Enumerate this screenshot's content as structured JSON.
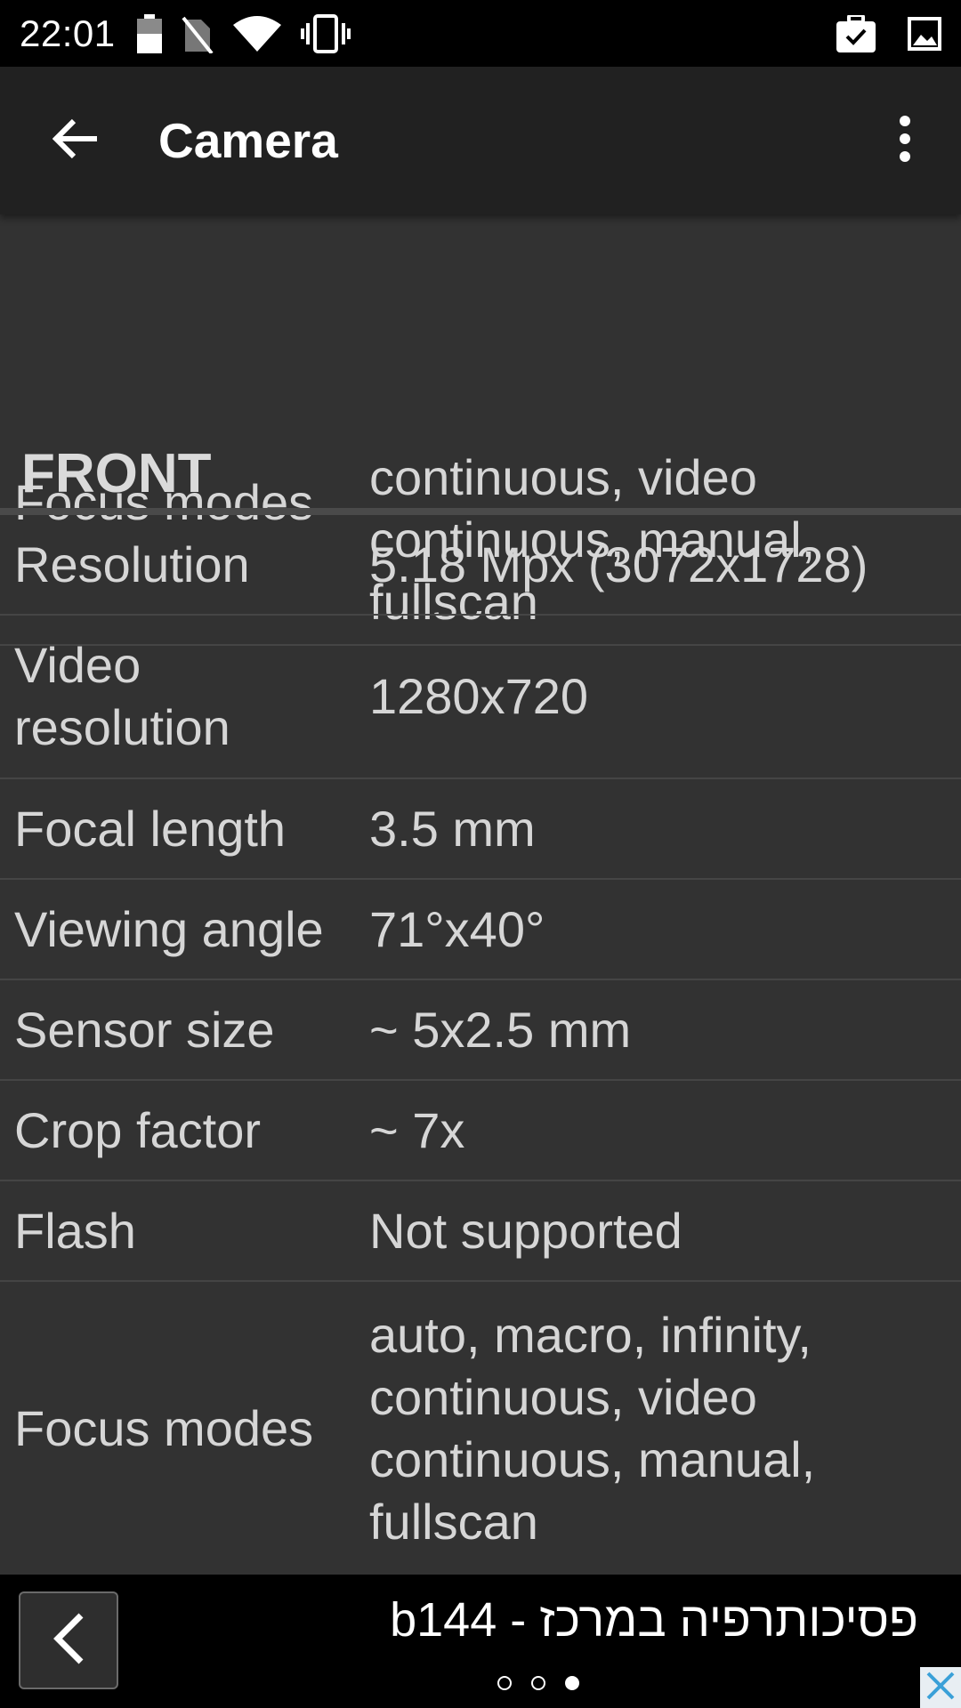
{
  "status_bar": {
    "time": "22:01",
    "icons": [
      "battery-icon",
      "no-sim-icon",
      "wifi-icon",
      "vibrate-icon",
      "briefcase-check-icon",
      "image-icon"
    ]
  },
  "app_bar": {
    "title": "Camera",
    "back_icon": "arrow-left-icon",
    "menu_icon": "more-vert-icon"
  },
  "rows_top": [
    {
      "label": "Focus modes",
      "value": "continuous, video continuous, manual, fullscan"
    }
  ],
  "section": {
    "title": "FRONT"
  },
  "rows_front": [
    {
      "label": "Resolution",
      "value": "5.18 Mpx (3072x1728)"
    },
    {
      "label": "Video resolution",
      "value": "1280x720"
    },
    {
      "label": "Focal length",
      "value": "3.5 mm"
    },
    {
      "label": "Viewing angle",
      "value": "71°x40°"
    },
    {
      "label": "Sensor size",
      "value": "~ 5x2.5 mm"
    },
    {
      "label": "Crop factor",
      "value": "~ 7x"
    },
    {
      "label": "Flash",
      "value": "Not supported"
    },
    {
      "label": "Focus modes",
      "value": "auto, macro, infinity, continuous, video continuous, manual, fullscan"
    }
  ],
  "ad": {
    "text": "פסיכותרפיה במרכז - b144",
    "dots": 3,
    "active_dot": 3
  }
}
